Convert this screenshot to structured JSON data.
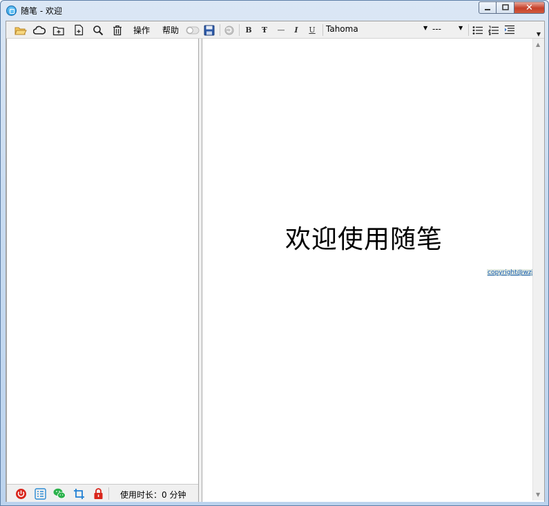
{
  "window": {
    "title": "随笔 - 欢迎",
    "minimize_glyph": "▁",
    "maximize_glyph": "□",
    "close_glyph": "✕"
  },
  "toolbar": {
    "menu_operate": "操作",
    "menu_help": "帮助",
    "font_name": "Tahoma",
    "font_size": "---",
    "buttons": {
      "bold": "B",
      "strike": "Ŧ",
      "hr": "—",
      "italic": "I",
      "underline": "U"
    }
  },
  "statusbar": {
    "usage_text": "使用时长：0 分钟"
  },
  "editor": {
    "welcome_text": "欢迎使用随笔",
    "copyright_text": "copyright@wzj"
  },
  "colors": {
    "power": "#d9261c",
    "list": "#2a8ad4",
    "wechat": "#2bb24c",
    "crop": "#1f7fd4",
    "lock": "#d9261c"
  }
}
